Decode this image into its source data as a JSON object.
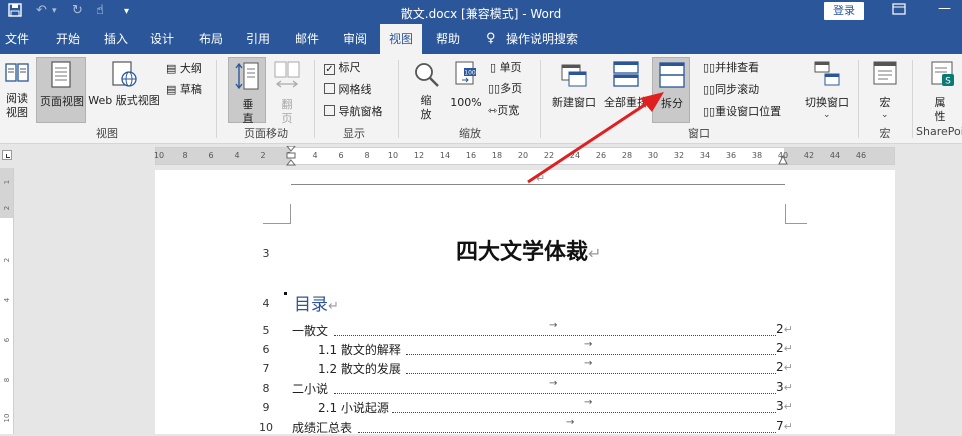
{
  "titlebar": {
    "title": "散文.docx [兼容模式]  -  Word",
    "login": "登录"
  },
  "menu": {
    "tabs": [
      "文件",
      "开始",
      "插入",
      "设计",
      "布局",
      "引用",
      "邮件",
      "审阅",
      "视图",
      "帮助"
    ],
    "tell_me": "操作说明搜索"
  },
  "ribbon": {
    "views": {
      "read_mode": "阅读视图",
      "print_layout": "页面视图",
      "web_layout": "Web 版式视图",
      "outline": "大纲",
      "draft": "草稿",
      "group": "视图"
    },
    "page_movement": {
      "vertical": "垂直",
      "side_to_side": "翻页",
      "group": "页面移动"
    },
    "show": {
      "ruler": "标尺",
      "gridlines": "网格线",
      "nav_pane": "导航窗格",
      "group": "显示",
      "ruler_checked": true
    },
    "zoom": {
      "zoom": "缩放",
      "percent": "100%",
      "one_page": "单页",
      "multiple_pages": "多页",
      "page_width": "页宽",
      "group": "缩放"
    },
    "window": {
      "new_window": "新建窗口",
      "arrange_all": "全部重排",
      "split": "拆分",
      "side_by_side": "并排查看",
      "sync_scroll": "同步滚动",
      "reset_position": "重设窗口位置",
      "switch_windows": "切换窗口",
      "group": "窗口"
    },
    "macros": {
      "macros": "宏",
      "group": "宏"
    },
    "sharepoint": {
      "properties": "属性",
      "group": "SharePoi"
    }
  },
  "ruler": {
    "ticks": [
      "10",
      "8",
      "6",
      "4",
      "2",
      "2",
      "4",
      "6",
      "8",
      "10",
      "12",
      "14",
      "16",
      "18",
      "20",
      "22",
      "24",
      "26",
      "28",
      "30",
      "32",
      "34",
      "36",
      "38",
      "40",
      "42",
      "44",
      "46"
    ]
  },
  "document": {
    "title": "四大文学体裁",
    "toc_heading": "目录",
    "toc": [
      {
        "line": "5",
        "text": "一散文",
        "page": "2"
      },
      {
        "line": "6",
        "text": "1.1 散文的解释",
        "page": "2"
      },
      {
        "line": "7",
        "text": "1.2 散文的发展",
        "page": "2"
      },
      {
        "line": "8",
        "text": "二小说",
        "page": "3"
      },
      {
        "line": "9",
        "text": "2.1 小说起源",
        "page": "3"
      },
      {
        "line": "10",
        "text": "成绩汇总表",
        "page": "7"
      }
    ],
    "line_title": "3",
    "line_heading": "4"
  },
  "colors": {
    "accent": "#2b579a",
    "arrow": "#e02020"
  }
}
